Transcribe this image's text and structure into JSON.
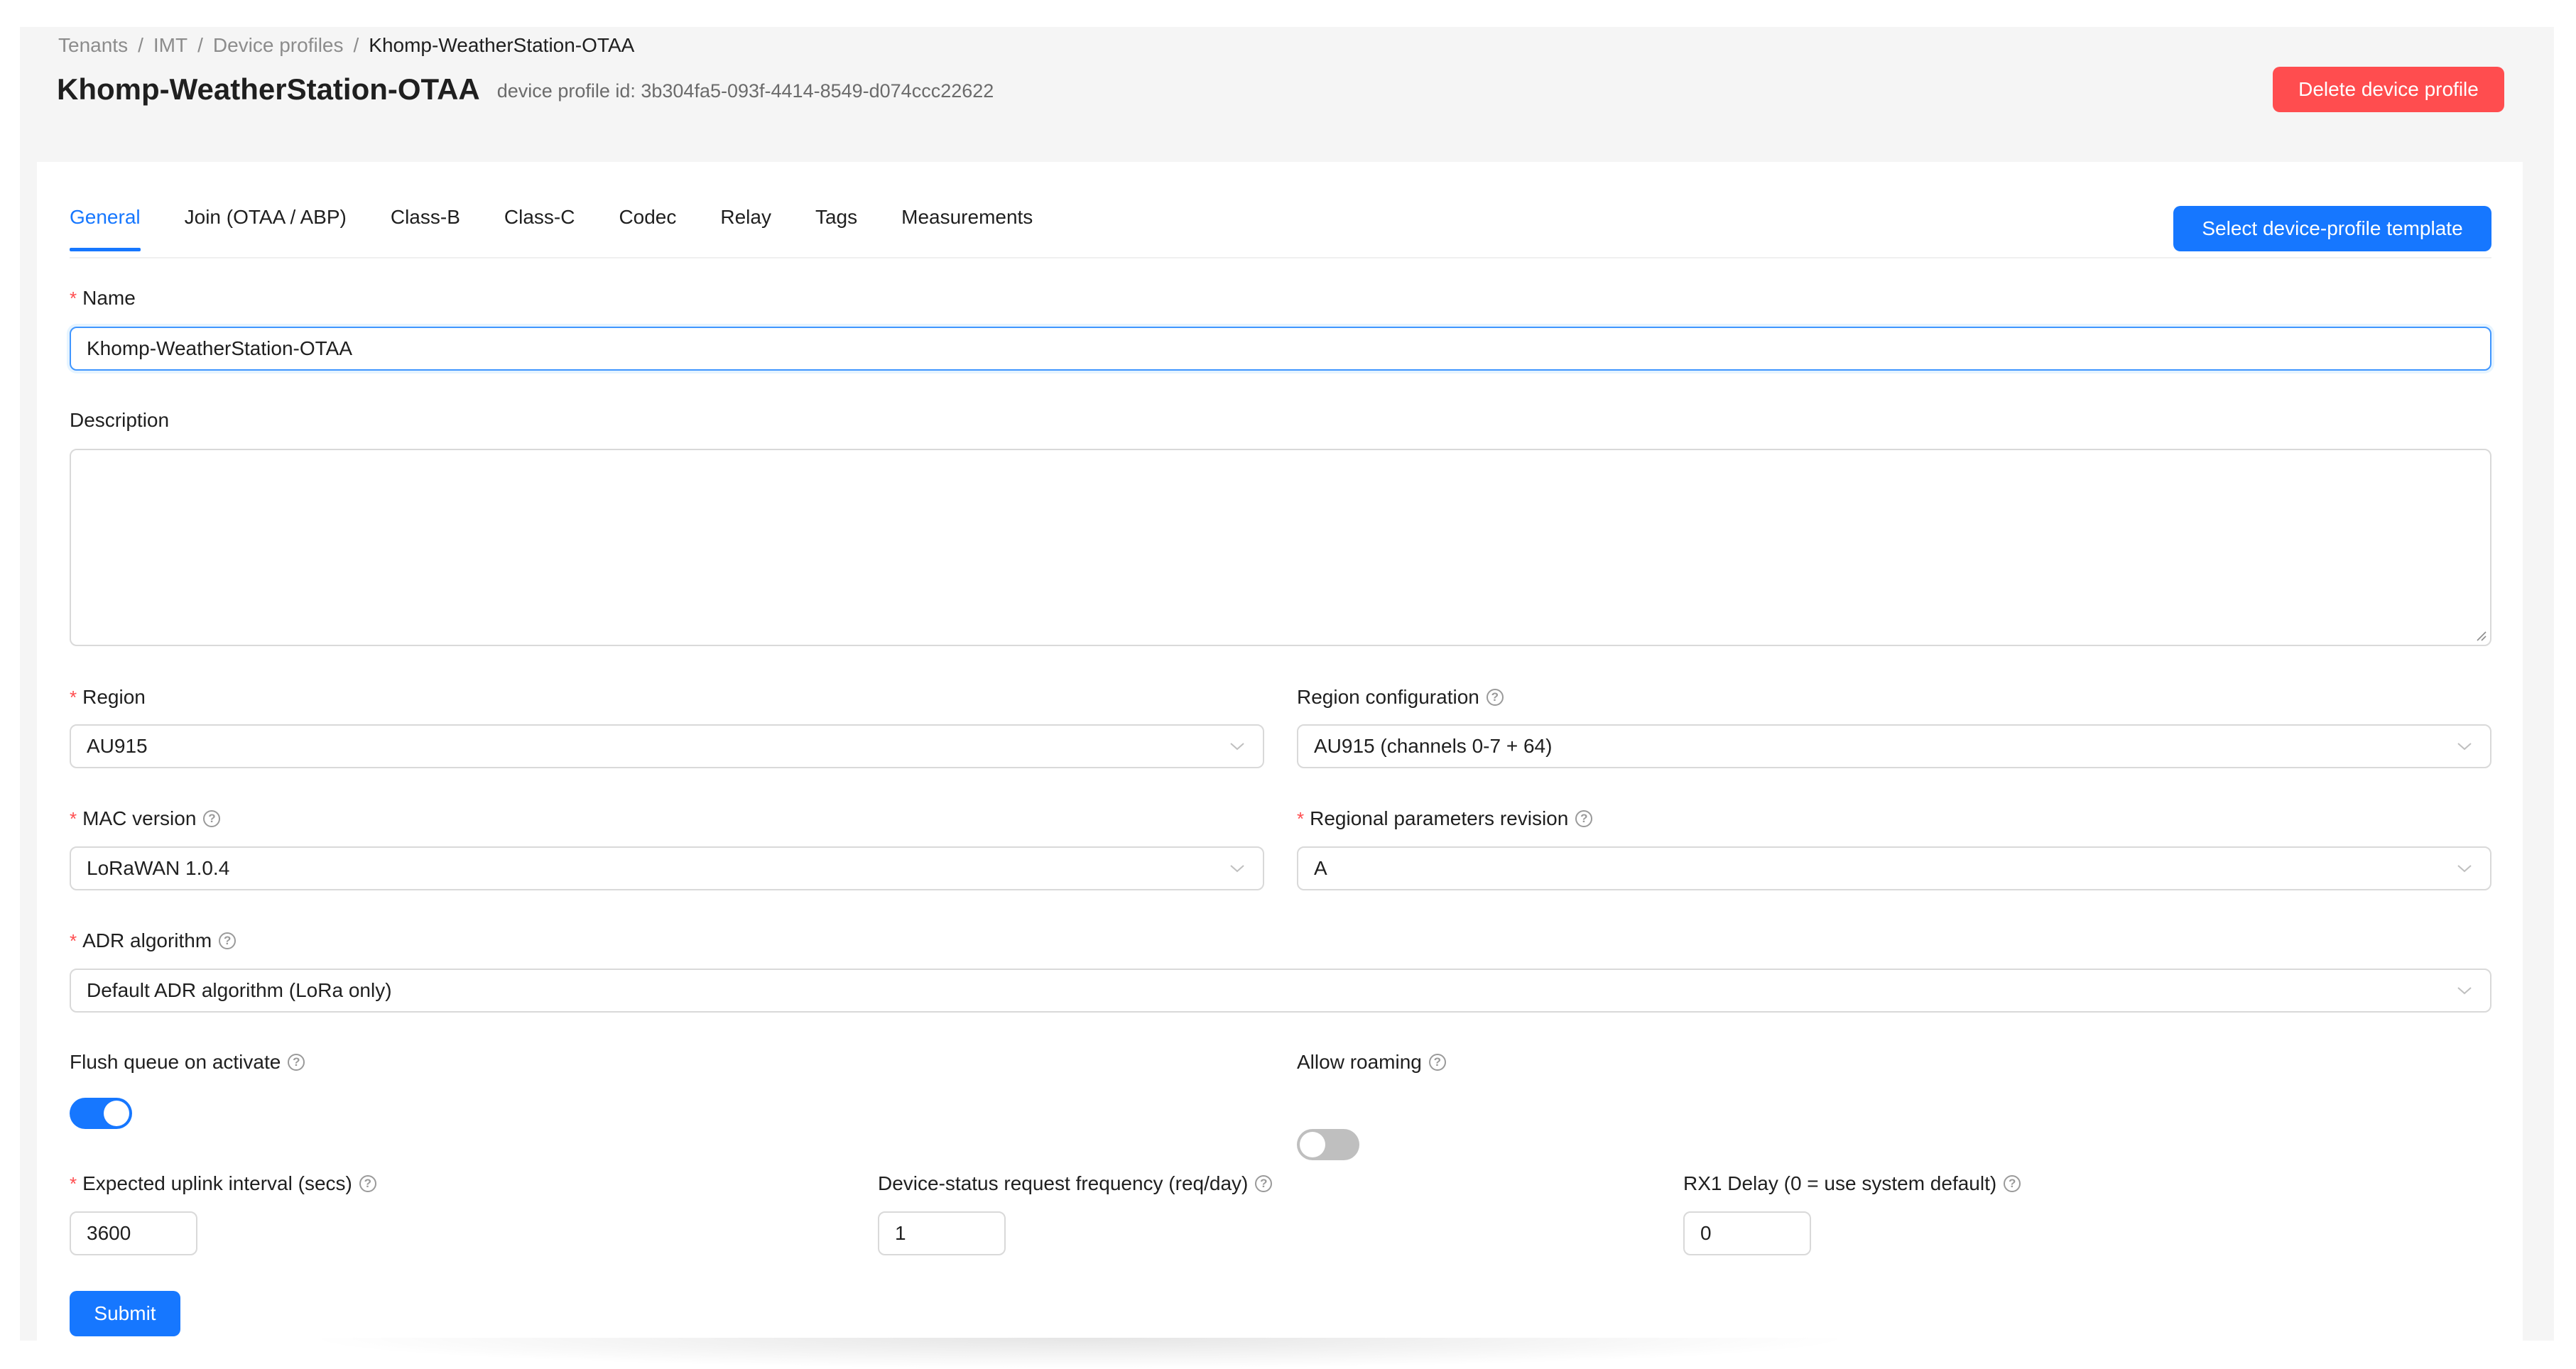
{
  "breadcrumb": {
    "items": [
      "Tenants",
      "IMT",
      "Device profiles"
    ],
    "separator": "/",
    "current": "Khomp-WeatherStation-OTAA"
  },
  "header": {
    "title": "Khomp-WeatherStation-OTAA",
    "subtitle": "device profile id: 3b304fa5-093f-4414-8549-d074ccc22622",
    "delete_label": "Delete device profile"
  },
  "tabs": [
    {
      "label": "General",
      "active": true
    },
    {
      "label": "Join (OTAA / ABP)",
      "active": false
    },
    {
      "label": "Class-B",
      "active": false
    },
    {
      "label": "Class-C",
      "active": false
    },
    {
      "label": "Codec",
      "active": false
    },
    {
      "label": "Relay",
      "active": false
    },
    {
      "label": "Tags",
      "active": false
    },
    {
      "label": "Measurements",
      "active": false
    }
  ],
  "template_button_label": "Select device-profile template",
  "form": {
    "required_mark": "*",
    "help_icon": "question-circle-icon",
    "name": {
      "label": "Name",
      "value": "Khomp-WeatherStation-OTAA"
    },
    "description": {
      "label": "Description",
      "value": ""
    },
    "region": {
      "label": "Region",
      "value": "AU915"
    },
    "region_config": {
      "label": "Region configuration",
      "value": "AU915 (channels 0-7 + 64)"
    },
    "mac_version": {
      "label": "MAC version",
      "value": "LoRaWAN 1.0.4"
    },
    "reg_params": {
      "label": "Regional parameters revision",
      "value": "A"
    },
    "adr": {
      "label": "ADR algorithm",
      "value": "Default ADR algorithm (LoRa only)"
    },
    "flush_queue": {
      "label": "Flush queue on activate",
      "on": true
    },
    "allow_roaming": {
      "label": "Allow roaming",
      "on": false
    },
    "uplink_interval": {
      "label": "Expected uplink interval (secs)",
      "value": "3600"
    },
    "status_freq": {
      "label": "Device-status request frequency (req/day)",
      "value": "1"
    },
    "rx1_delay": {
      "label": "RX1 Delay (0 = use system default)",
      "value": "0"
    }
  },
  "submit_label": "Submit",
  "colors": {
    "primary": "#1677ff",
    "danger": "#ff4d4f",
    "required": "#ff4d4f",
    "switch_off": "#bfbfbf"
  }
}
